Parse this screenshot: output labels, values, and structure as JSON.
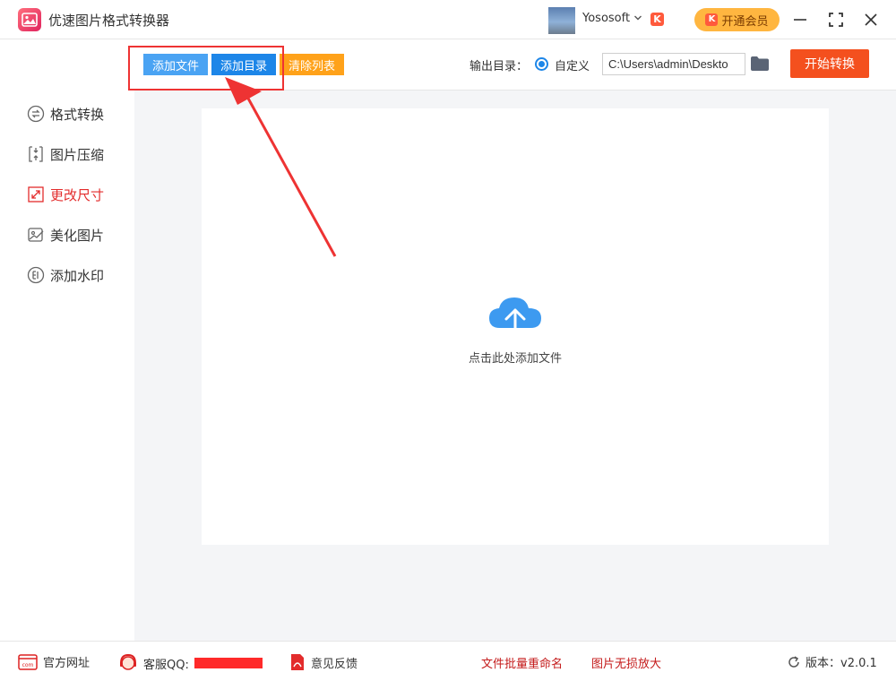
{
  "app": {
    "title": "优速图片格式转换器"
  },
  "user": {
    "name": "Yososoft",
    "badge": "K"
  },
  "header": {
    "vip_label": "开通会员"
  },
  "toolbar": {
    "add_file": "添加文件",
    "add_dir": "添加目录",
    "clear_list": "清除列表",
    "output_label": "输出目录：",
    "custom_option": "自定义",
    "output_path": "C:\\Users\\admin\\Deskto",
    "start": "开始转换"
  },
  "sidebar": {
    "items": [
      {
        "label": "格式转换",
        "icon": "format-convert-icon",
        "active": false
      },
      {
        "label": "图片压缩",
        "icon": "compress-icon",
        "active": false
      },
      {
        "label": "更改尺寸",
        "icon": "resize-icon",
        "active": true
      },
      {
        "label": "美化图片",
        "icon": "beautify-icon",
        "active": false
      },
      {
        "label": "添加水印",
        "icon": "watermark-icon",
        "active": false
      }
    ]
  },
  "main": {
    "drop_text": "点击此处添加文件"
  },
  "footer": {
    "website": "官方网址",
    "qq": "客服QQ:",
    "feedback": "意见反馈",
    "batch_rename": "文件批量重命名",
    "lossless_enlarge": "图片无损放大",
    "version": "版本：v2.0.1"
  },
  "colors": {
    "accent_blue": "#1d86e8",
    "start_button": "#f4501e",
    "clear_button": "#ffa21a",
    "active_nav": "#e32c2c",
    "annotation": "#ee3333"
  }
}
